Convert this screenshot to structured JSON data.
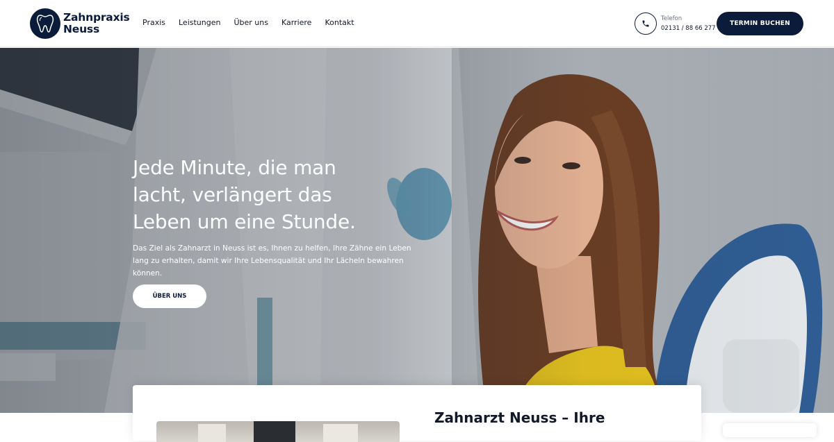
{
  "header": {
    "logo": {
      "line1": "Zahnpraxis",
      "line2": "Neuss",
      "icon": "tooth-icon"
    },
    "nav": [
      "Praxis",
      "Leistungen",
      "Über uns",
      "Karriere",
      "Kontakt"
    ],
    "phone": {
      "label": "Telefon",
      "number": "02131 / 88 66 277",
      "icon": "phone-icon"
    },
    "cta_label": "TERMIN BUCHEN"
  },
  "hero": {
    "title_lines": [
      "Jede Minute, die man",
      "lacht, verlängert das",
      "Leben um eine Stunde."
    ],
    "subtitle": "Das Ziel als Zahnarzt in Neuss ist es, Ihnen zu helfen, Ihre Zähne ein Leben lang zu erhalten, damit wir Ihre Lebensqualität und Ihr Lächeln bewahren können.",
    "button_label": "ÜBER UNS"
  },
  "intro": {
    "title": "Zahnarzt Neuss – Ihre"
  },
  "colors": {
    "brand": "#0b1b3a",
    "white": "#ffffff"
  }
}
